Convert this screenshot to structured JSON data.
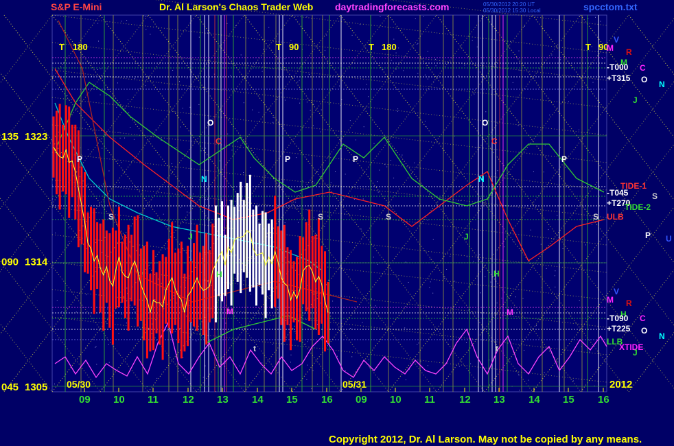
{
  "header": {
    "instrument": "S&P E-Mini",
    "site_title": "Dr. Al Larson's Chaos Trader Web",
    "site_url": "daytradingforecasts.com",
    "stamp_1": "05/30/2012 20:20 UT",
    "stamp_2": "05/30/2012 15:30 Local",
    "file": "spcctom.txt"
  },
  "footer": {
    "copyright": "Copyright 2012, Dr. Al Larson. May not be copied by any means."
  },
  "chart_data": {
    "type": "line",
    "ylim": [
      1305,
      1328
    ],
    "y_axis_ticks": [
      {
        "angle": "135",
        "price": "1323",
        "value": 1323
      },
      {
        "angle": "090",
        "price": "1314",
        "value": 1314
      },
      {
        "angle": "045",
        "price": "1305",
        "value": 1305
      }
    ],
    "x_hour_ticks": [
      "09",
      "10",
      "11",
      "12",
      "13",
      "14",
      "15",
      "16",
      "09",
      "10",
      "11",
      "12",
      "13",
      "14",
      "15",
      "16"
    ],
    "day_labels": [
      "05/30",
      "05/31"
    ],
    "year_label": "2012",
    "t_markers": [
      "T",
      "180",
      "T",
      "90",
      "T",
      "180",
      "T",
      "90"
    ],
    "right_labels": [
      {
        "text": "V",
        "color": "#3355ff"
      },
      {
        "text": "M",
        "color": "#ff22ff"
      },
      {
        "text": "R",
        "color": "#dd1111"
      },
      {
        "text": "M",
        "color": "#33dd33"
      },
      {
        "text": "-T000",
        "color": "#ffffff"
      },
      {
        "text": "C",
        "color": "#ff22ff"
      },
      {
        "text": "+T315",
        "color": "#ffffff"
      },
      {
        "text": "O",
        "color": "#ffffff"
      },
      {
        "text": "N",
        "color": "#00ffff"
      },
      {
        "text": "J",
        "color": "#33dd33"
      },
      {
        "text": "TIDE-1",
        "color": "#ff3333"
      },
      {
        "text": "-T045",
        "color": "#ffffff"
      },
      {
        "text": "S",
        "color": "#cccccc"
      },
      {
        "text": "+T270",
        "color": "#ffffff"
      },
      {
        "text": "TIDE-2",
        "color": "#33dd33"
      },
      {
        "text": "ULB",
        "color": "#ff3333"
      },
      {
        "text": "P",
        "color": "#ffffff"
      },
      {
        "text": "U",
        "color": "#3355ff"
      },
      {
        "text": "V",
        "color": "#3355ff"
      },
      {
        "text": "M",
        "color": "#ff22ff"
      },
      {
        "text": "R",
        "color": "#dd1111"
      },
      {
        "text": "H",
        "color": "#33dd33"
      },
      {
        "text": "-T090",
        "color": "#ffffff"
      },
      {
        "text": "C",
        "color": "#ff22ff"
      },
      {
        "text": "+T225",
        "color": "#ffffff"
      },
      {
        "text": "O",
        "color": "#ffffff"
      },
      {
        "text": "N",
        "color": "#00ffff"
      },
      {
        "text": "LLB",
        "color": "#33dd33"
      },
      {
        "text": "XTIDE",
        "color": "#ff22ff"
      },
      {
        "text": "J",
        "color": "#33dd33"
      }
    ],
    "planet_labels": [
      "P",
      "S",
      "J",
      "N",
      "O",
      "C",
      "H",
      "M",
      "P",
      "S",
      "P",
      "S",
      "N",
      "O",
      "C",
      "M",
      "H",
      "J",
      "P",
      "S",
      "t",
      "t"
    ],
    "series": [
      {
        "color": "#ff2222",
        "values": [
          1322.2,
          1321.8,
          1321.5,
          1321.4,
          1322.0,
          1321.1,
          1321.2,
          1320.4,
          1319.2,
          1318.0,
          1316.8,
          1315.3,
          1314.9,
          1314.0,
          1314.4,
          1313.5,
          1313.0,
          1313.6,
          1312.6,
          1312.2,
          1313.4,
          1314.3,
          1313.2,
          1312.9,
          1312.8,
          1313.5,
          1314.0,
          1313.3,
          1312.3,
          1311.7,
          1311.2,
          1310.3,
          1311.2,
          1311.0,
          1311.0,
          1310.7,
          1311.9,
          1312.4,
          1312.8,
          1312.0,
          1311.5,
          1311.2,
          1310.3,
          1311.5,
          1311.8,
          1312.3,
          1312.8,
          1312.2,
          1311.9,
          1312.0,
          1312.2,
          1313.3,
          1313.8,
          1314.3,
          1314.7,
          1313.7,
          1315.0,
          1314.6,
          1315.5,
          1315.7,
          1315.7,
          1315.8,
          1316.2,
          1316.0,
          1314.9,
          1314.4,
          1314.5,
          1314.6,
          1313.7,
          1314.3,
          1313.8,
          1314.7,
          1313.9,
          1312.8,
          1312.4,
          1312.2,
          1311.2,
          1311.8,
          1311.3,
          1312.0,
          1313.3,
          1313.6,
          1313.7,
          1313.2,
          1312.5,
          1312.9,
          1312.3,
          1311.1,
          1310.3
        ]
      }
    ]
  }
}
